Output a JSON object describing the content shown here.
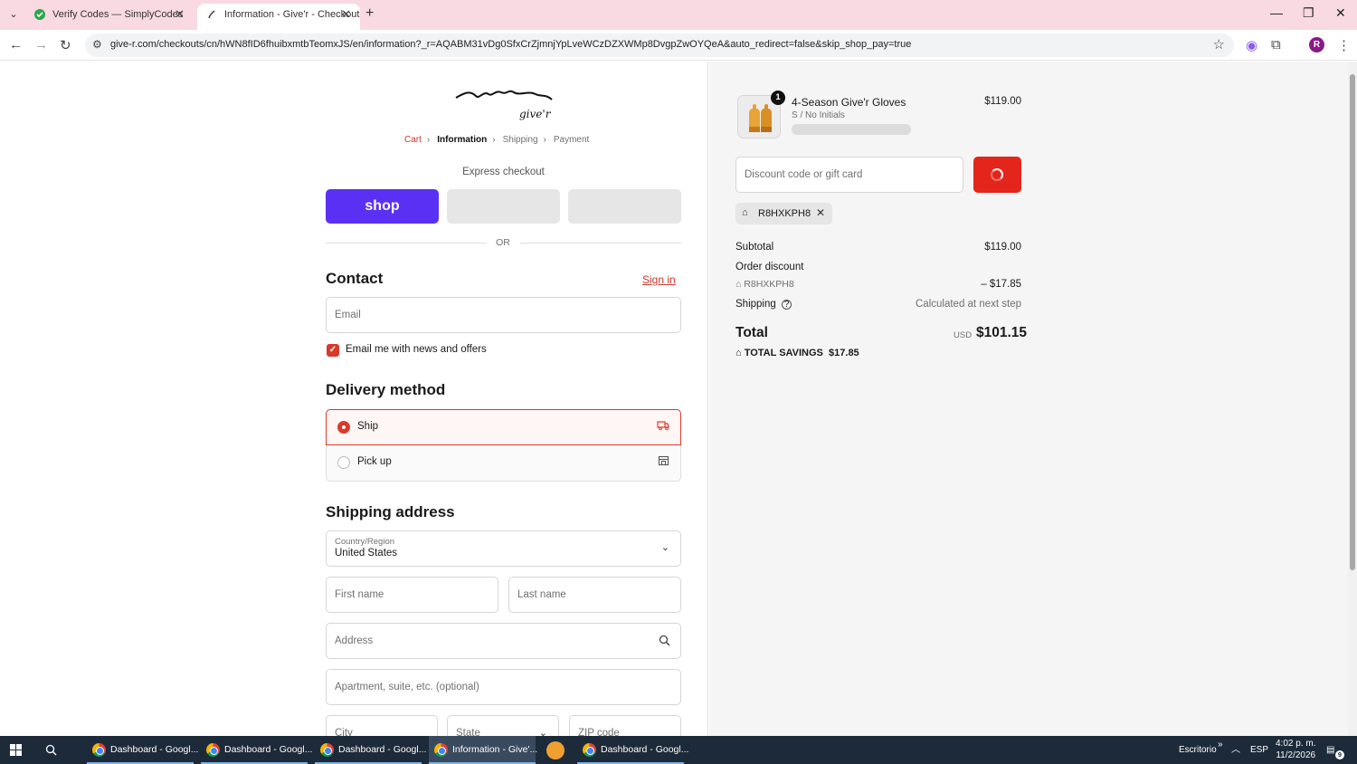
{
  "browser": {
    "tabs": [
      {
        "title": "Verify Codes — SimplyCodes"
      },
      {
        "title": "Information - Give'r - Checkout"
      }
    ],
    "url": "give-r.com/checkouts/cn/hWN8fID6fhuibxmtbTeomxJS/en/information?_r=AQABM31vDg0SfxCrZjmnjYpLveWCzDZXWMp8DvgpZwOYQeA&auto_redirect=false&skip_shop_pay=true",
    "profile_initial": "R"
  },
  "checkout": {
    "logo_text": "give'r",
    "breadcrumb": [
      "Cart",
      "Information",
      "Shipping",
      "Payment"
    ],
    "express_title": "Express checkout",
    "shop_label": "shop",
    "or_label": "OR",
    "contact": {
      "title": "Contact",
      "sign_in": "Sign in",
      "email_placeholder": "Email",
      "news_label": "Email me with news and offers"
    },
    "delivery": {
      "title": "Delivery method",
      "ship": "Ship",
      "pickup": "Pick up"
    },
    "shipping": {
      "title": "Shipping address",
      "country_label": "Country/Region",
      "country_value": "United States",
      "first_name": "First name",
      "last_name": "Last name",
      "address": "Address",
      "apartment": "Apartment, suite, etc. (optional)",
      "city": "City",
      "state": "State",
      "zip": "ZIP code"
    }
  },
  "summary": {
    "product": {
      "quantity": "1",
      "name": "4-Season Give'r Gloves",
      "variant": "S / No Initials",
      "price": "$119.00"
    },
    "discount_placeholder": "Discount code or gift card",
    "applied_code": "R8HXKPH8",
    "subtotal_label": "Subtotal",
    "subtotal_value": "$119.00",
    "order_discount_label": "Order discount",
    "discount_code": "R8HXKPH8",
    "discount_value": "– $17.85",
    "shipping_label": "Shipping",
    "shipping_value": "Calculated at next step",
    "total_label": "Total",
    "currency": "USD",
    "total_value": "$101.15",
    "savings_label": "TOTAL SAVINGS",
    "savings_value": "$17.85"
  },
  "taskbar": {
    "items": [
      "Dashboard - Googl...",
      "Dashboard - Googl...",
      "Dashboard - Googl...",
      "Information - Give'...",
      "Dashboard - Googl..."
    ],
    "desktop_label": "Escritorio",
    "lang": "ESP",
    "time": "4:02 p. m.",
    "date": "11/2/2026",
    "notif_count": "9"
  },
  "colors": {
    "accent": "#d83a2b",
    "shop_purple": "#5a31f4",
    "tab_bar": "#f9d9e2"
  }
}
